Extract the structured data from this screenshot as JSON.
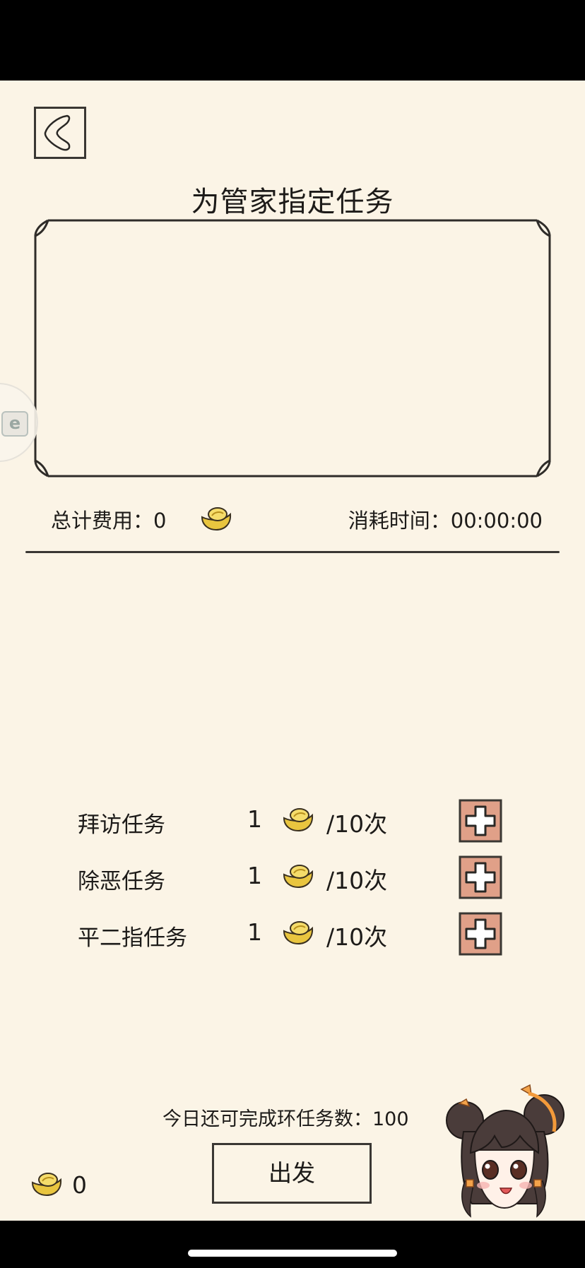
{
  "header": {
    "title": "为管家指定任务"
  },
  "summary": {
    "total_cost_label": "总计费用：",
    "total_cost_value": "0",
    "time_label": "消耗时间：",
    "time_value": "00:00:00"
  },
  "tasks": [
    {
      "name": "拜访任务",
      "cost": "1",
      "limit": "/10次"
    },
    {
      "name": "除恶任务",
      "cost": "1",
      "limit": "/10次"
    },
    {
      "name": "平二指任务",
      "cost": "1",
      "limit": "/10次"
    }
  ],
  "footer": {
    "remaining_text": "今日还可完成环任务数：100",
    "go_button": "出发",
    "wallet_value": "0"
  },
  "icons": {
    "back": "back-arrow-icon",
    "currency": "gold-ingot-icon",
    "add": "plus-icon",
    "assistant": "girl-avatar-icon"
  },
  "colors": {
    "paper": "#fbf4e6",
    "ink": "#1d1b19",
    "plus_button": "#e0a088",
    "gold": "#e9c53f"
  }
}
